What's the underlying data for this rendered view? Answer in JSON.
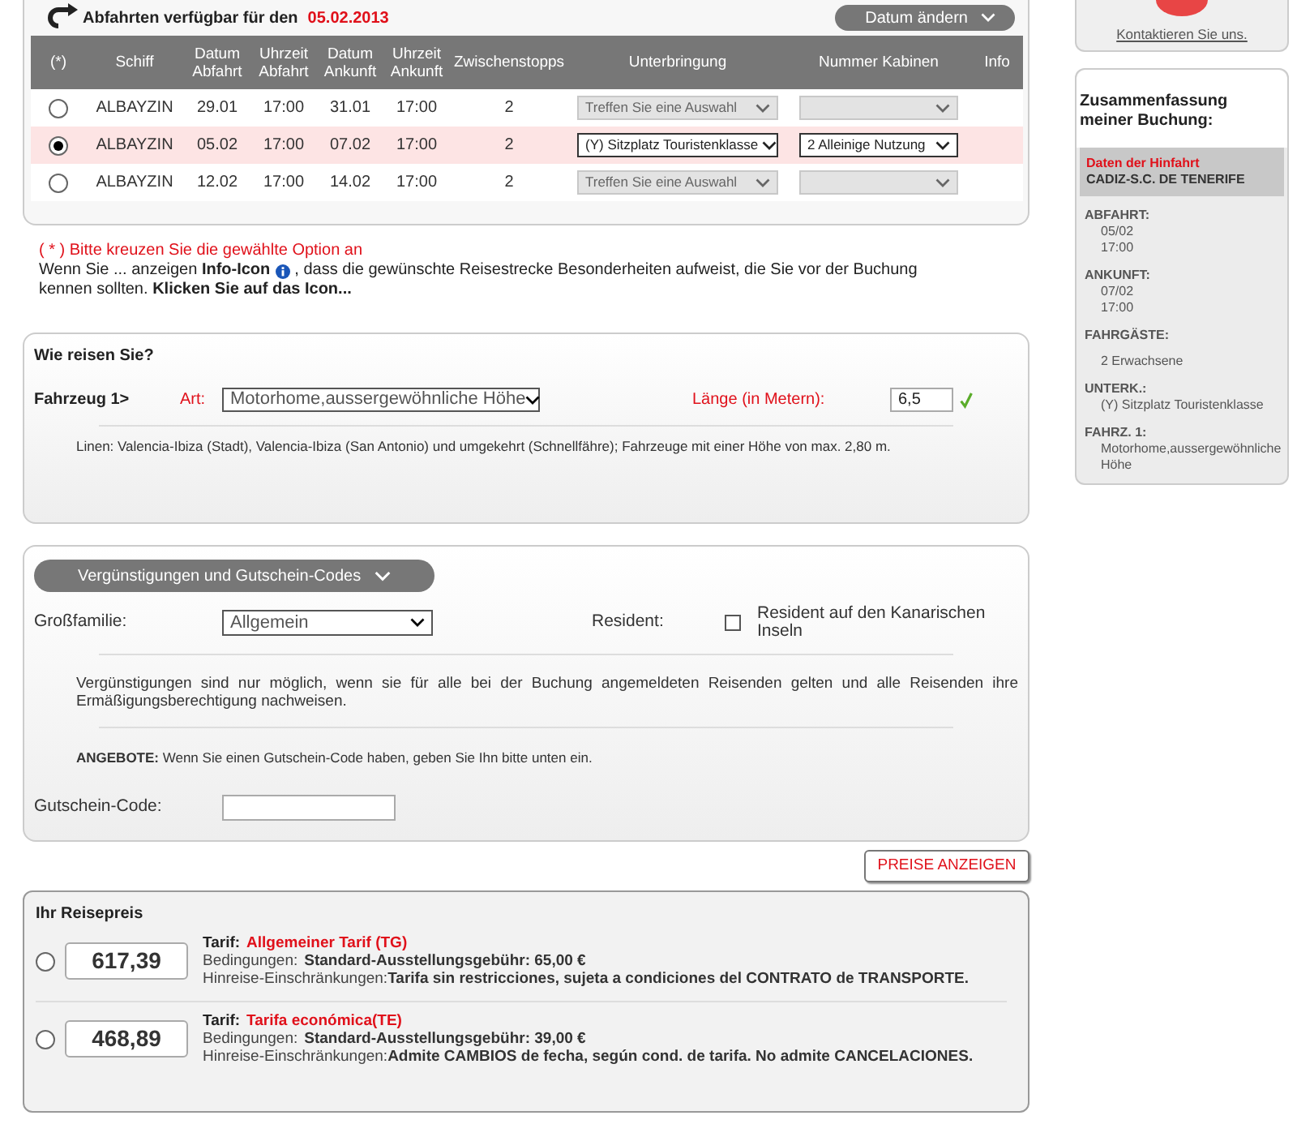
{
  "departures": {
    "title": "Abfahrten verfügbar für den",
    "date": "05.02.2013",
    "change_date_button": "Datum ändern",
    "columns": [
      "(*)",
      "Schiff",
      "Datum Abfahrt",
      "Uhrzeit Abfahrt",
      "Datum Ankunft",
      "Uhrzeit Ankunft",
      "Zwischenstopps",
      "Unterbringung",
      "Nummer Kabinen",
      "Info"
    ],
    "rows": [
      {
        "selected": false,
        "ship": "ALBAYZIN",
        "departure_date": "29.01",
        "departure_time": "17:00",
        "arrival_date": "31.01",
        "arrival_time": "17:00",
        "stops": "2",
        "accommodation": "Treffen Sie eine Auswahl",
        "accommodation_disabled": true,
        "cabins_disabled": true
      },
      {
        "selected": true,
        "ship": "ALBAYZIN",
        "departure_date": "05.02",
        "departure_time": "17:00",
        "arrival_date": "07.02",
        "arrival_time": "17:00",
        "stops": "2",
        "accommodation": "(Y) Sitzplatz Touristenklasse",
        "accommodation_disabled": false,
        "cabins": "2 Alleinige Nutzung",
        "cabins_disabled": false
      },
      {
        "selected": false,
        "ship": "ALBAYZIN",
        "departure_date": "12.02",
        "departure_time": "17:00",
        "arrival_date": "14.02",
        "arrival_time": "17:00",
        "stops": "2",
        "accommodation": "Treffen Sie eine Auswahl",
        "accommodation_disabled": true,
        "cabins_disabled": true
      }
    ]
  },
  "notes": {
    "required": "( * ) Bitte kreuzen Sie die gewählte Option an",
    "info_before": "Wenn Sie ... anzeigen **Info-Icon**",
    "info_after": ", dass die gewünschte Reisestrecke Besonderheiten aufweist, die Sie vor der Buchung",
    "info_line2": "kennen sollten. **Klicken Sie auf das Icon...**"
  },
  "travel": {
    "title": "Wie reisen Sie?",
    "vehicle_label": "Fahrzeug 1>",
    "type_label": "Art:",
    "type_value": "Motorhome,aussergewöhnliche Höhe",
    "length_label": "Länge (in Metern):",
    "length_value": "6,5",
    "length_valid": true,
    "note": "Linen: Valencia-Ibiza (Stadt), Valencia-Ibiza (San Antonio) und umgekehrt (Schnellfähre); Fahrzeuge mit einer Höhe von max. 2,80 m."
  },
  "discounts": {
    "toggle": "Vergünstigungen und Gutschein-Codes",
    "large_family_label": "Großfamilie:",
    "large_family_value": "Allgemein",
    "resident_label": "Resident:",
    "resident_checked": false,
    "resident_option": "Resident auf den Kanarischen Inseln",
    "note": "Vergünstigungen sind nur möglich, wenn sie für alle bei der Buchung angemeldeten Reisenden gelten und alle Reisenden ihre Ermäßigungsberechtigung nachweisen.",
    "offers": "**ANGEBOTE:** Wenn Sie einen Gutschein-Code haben, geben Sie Ihn bitte unten ein.",
    "voucher_label": "Gutschein-Code:"
  },
  "show_prices_button": "PREISE ANZEIGEN",
  "prices": {
    "title": "Ihr Reisepreis",
    "options": [
      {
        "selected": false,
        "price": "617,39",
        "tariff_label": "Tarif:",
        "tariff": "Allgemeiner Tarif (TG)",
        "conditions_label": "Bedingungen:",
        "conditions": "Standard-Ausstellungsgebühr: 65,00 €",
        "restrictions": "Hinreise-Einschränkungen:**Tarifa sin restricciones, sujeta a condiciones del CONTRATO de TRANSPORTE.**"
      },
      {
        "selected": false,
        "price": "468,89",
        "tariff_label": "Tarif:",
        "tariff": "Tarifa económica(TE)",
        "conditions_label": "Bedingungen:",
        "conditions": "Standard-Ausstellungsgebühr: 39,00 €",
        "restrictions": "Hinreise-Einschränkungen:**Admite CAMBIOS de fecha, según cond. de tarifa. No admite CANCELACIONES.**"
      }
    ]
  },
  "sidebar": {
    "contact_link": "Kontaktieren Sie uns.",
    "summary_title": "Zusammenfassung meiner Buchung:",
    "trip_label": "Daten der Hinfahrt",
    "route": "CADIZ-S.C. DE TENERIFE",
    "items": [
      {
        "label": "ABFAHRT:",
        "lines": [
          "05/02",
          "17:00"
        ]
      },
      {
        "label": "ANKUNFT:",
        "lines": [
          "07/02",
          "17:00"
        ]
      },
      {
        "label": "FAHRGÄSTE:",
        "lines": [
          "2 Erwachsene"
        ]
      },
      {
        "label": "UNTERK.:",
        "lines": [
          "(Y) Sitzplatz Touristenklasse"
        ]
      },
      {
        "label": "FAHRZ. 1:",
        "lines": [
          "Motorhome,aussergewöhnliche Höhe"
        ]
      }
    ]
  }
}
